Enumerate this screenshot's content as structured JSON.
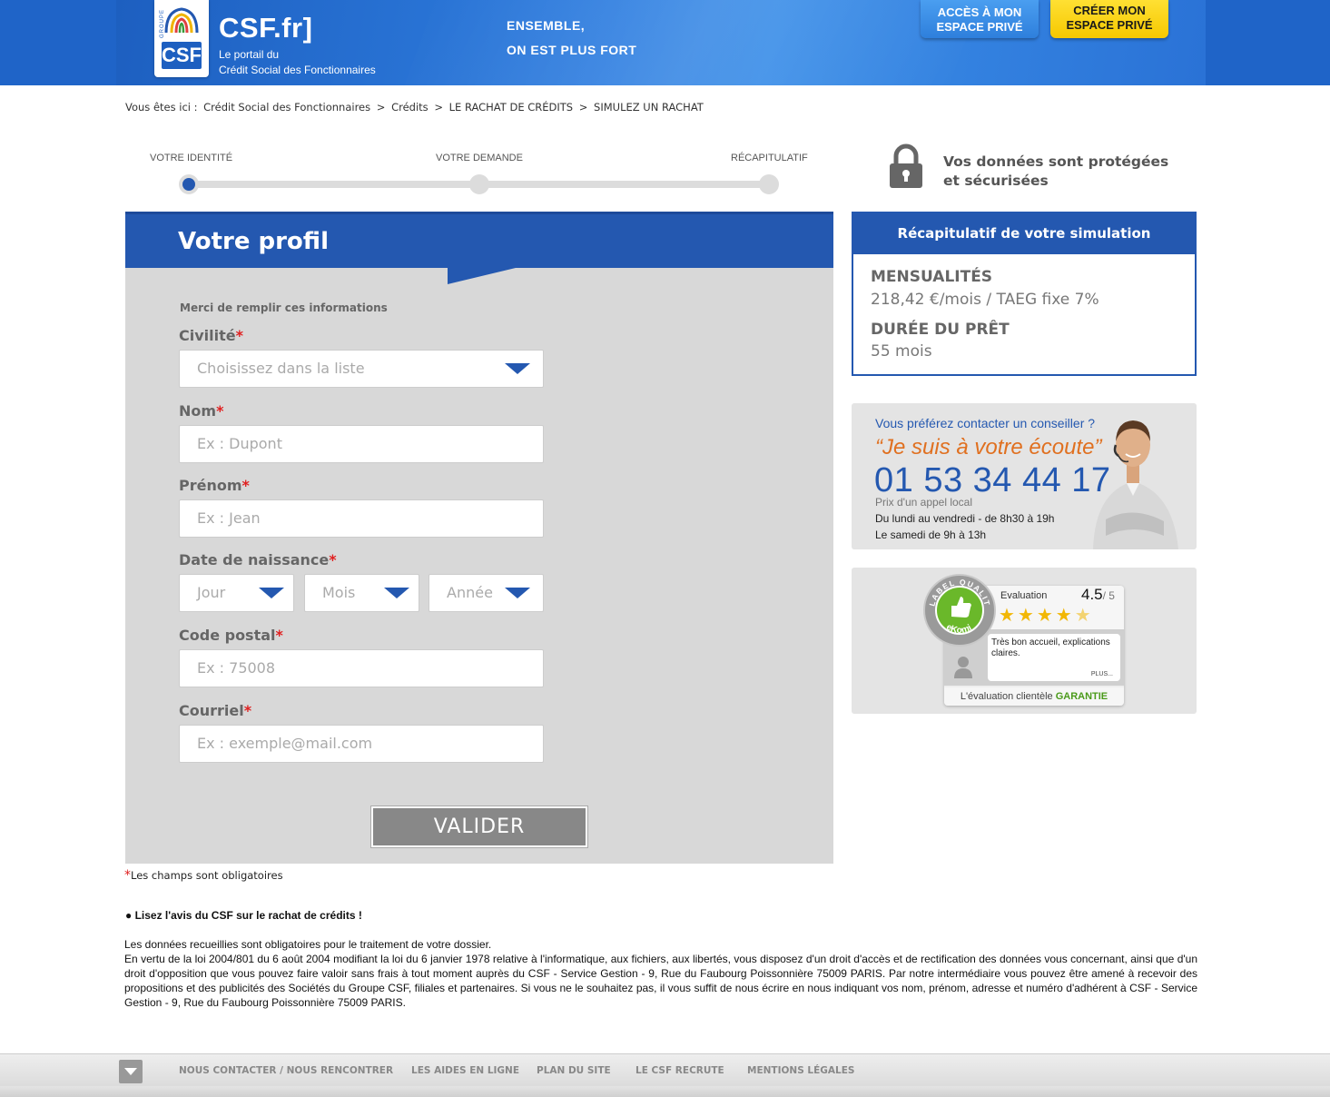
{
  "header": {
    "title": "CSF.fr]",
    "subtitle_line1": "Le portail du",
    "subtitle_line2": "Crédit Social des Fonctionnaires",
    "logo_groupe": "GROUPE",
    "logo_csf": "CSF",
    "slogan_line1": "ENSEMBLE,",
    "slogan_line2": "ON EST PLUS FORT",
    "btn_acces_line1": "ACCÈS À MON",
    "btn_acces_line2": "ESPACE PRIVÉ",
    "btn_creer_line1": "CRÉER MON",
    "btn_creer_line2": "ESPACE PRIVÉ",
    "colors": {
      "brand_blue": "#2458b0",
      "accent_yellow": "#f6c800"
    }
  },
  "breadcrumb": {
    "prefix": "Vous êtes ici :",
    "items": [
      "Crédit Social des Fonctionnaires",
      ">",
      "Crédits",
      ">",
      "LE RACHAT DE CRÉDITS",
      ">",
      "SIMULEZ UN RACHAT"
    ]
  },
  "steps": {
    "items": [
      {
        "label": "VOTRE IDENTITÉ",
        "active": true
      },
      {
        "label": "VOTRE DEMANDE",
        "active": false
      },
      {
        "label": "RÉCAPITULATIF",
        "active": false
      }
    ]
  },
  "secure": {
    "line1": "Vos données sont protégées",
    "line2": "et sécurisées",
    "icon": "lock-icon"
  },
  "form": {
    "title": "Votre profil",
    "intro": "Merci de remplir ces informations",
    "required_mark": "*",
    "civilite": {
      "label": "Civilité",
      "placeholder": "Choisissez dans la liste"
    },
    "nom": {
      "label": "Nom",
      "placeholder": "Ex : Dupont"
    },
    "prenom": {
      "label": "Prénom",
      "placeholder": "Ex : Jean"
    },
    "naissance": {
      "label": "Date de naissance",
      "jour": "Jour",
      "mois": "Mois",
      "annee": "Année"
    },
    "code_postal": {
      "label": "Code postal",
      "placeholder": "Ex : 75008"
    },
    "courriel": {
      "label": "Courriel",
      "placeholder": "Ex : exemple@mail.com"
    },
    "submit": "VALIDER"
  },
  "notes": {
    "required_note": "Les champs sont obligatoires",
    "avis": "● Lisez l'avis du CSF sur le rachat de crédits !",
    "legal_line1": "Les données recueillies sont obligatoires pour le traitement de votre dossier.",
    "legal_line2": "En vertu de la loi 2004/801 du 6 août 2004 modifiant la loi du 6 janvier 1978 relative à l'informatique, aux fichiers, aux libertés, vous disposez d'un droit d'accès et de rectification des données vous concernant, ainsi que d'un droit d'opposition que vous pouvez faire valoir sans frais à tout moment auprès du CSF - Service Gestion - 9, Rue du Faubourg Poissonnière 75009 PARIS. Par notre intermédiaire vous pouvez être amené à recevoir des propositions et des publicités des Sociétés du Groupe CSF, filiales et partenaires. Si vous ne le souhaitez pas, il vous suffit de nous écrire en nous indiquant vos nom, prénom, adresse et numéro d'adhérent à CSF - Service Gestion - 9, Rue du Faubourg Poissonnière 75009 PARIS."
  },
  "recap": {
    "title": "Récapitulatif de votre simulation",
    "mensualites_label": "MENSUALITÉS",
    "mensualites_value": "218,42 €/mois / TAEG fixe 7%",
    "duree_label": "DURÉE DU PRÊT",
    "duree_value": "55 mois"
  },
  "contact": {
    "question": "Vous préférez contacter un conseiller ?",
    "quote": "“Je suis à votre écoute”",
    "phone": "01 53 34 44 17",
    "prix": "Prix d'un appel local",
    "hours1": "Du lundi au vendredi - de 8h30 à 19h",
    "hours2": "Le samedi de 9h à 13h"
  },
  "ekomi": {
    "evaluation_label": "Evaluation",
    "score": "4.5",
    "score_max": "/ 5",
    "rating": 4.5,
    "review": "Très bon accueil, explications claires.",
    "plus": "PLUS...",
    "bottom_text": "L'évaluation clientèle",
    "bottom_strong": "GARANTIE",
    "badge_text": "LABEL QUALITÉ",
    "badge_brand": "eKomi"
  },
  "footer": {
    "links": [
      "NOUS CONTACTER / NOUS RENCONTRER",
      "LES AIDES EN LIGNE",
      "PLAN DU SITE",
      "LE CSF RECRUTE",
      "MENTIONS LÉGALES"
    ]
  }
}
